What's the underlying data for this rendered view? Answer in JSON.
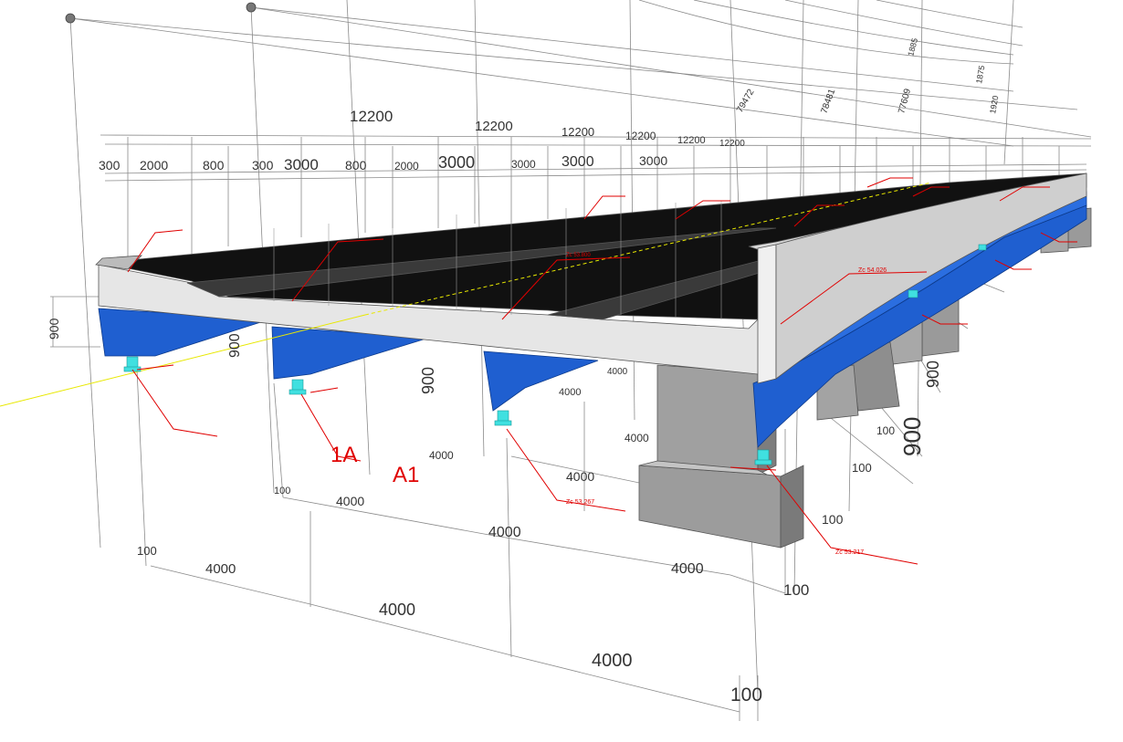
{
  "colors": {
    "background": "#ffffff",
    "dimension_line": "#8a8a8a",
    "deck_surface": "#111111",
    "deck_concrete": "#e6e6e6",
    "steel_girder": "#1f5fd0",
    "bearing": "#40e0e0",
    "pier": "#9a9a9a",
    "annotation": "#e00000",
    "centerline": "#e8e800"
  },
  "dimensions": {
    "top_spans": [
      "12200",
      "12200",
      "12200",
      "12200",
      "12200",
      "12200"
    ],
    "top_row_values": [
      "300",
      "2000",
      "800",
      "300",
      "3000",
      "800",
      "2000",
      "3000",
      "3000",
      "3000",
      "3000"
    ],
    "girder_heights": [
      "900",
      "900",
      "900",
      "900",
      "900"
    ],
    "bottom_spacing_row1": [
      "100",
      "4000",
      "4000",
      "4000",
      "100"
    ],
    "bottom_spacing_row2": [
      "100",
      "4000",
      "4000",
      "4000",
      "100"
    ],
    "right_side_values": [
      "4000",
      "4000",
      "4000",
      "100",
      "100",
      "100",
      "4000",
      "4000"
    ],
    "upper_diagonal_values": [
      "79472",
      "78481",
      "77609",
      "1885",
      "1875",
      "1920"
    ]
  },
  "labels": {
    "abutment_1": "1A",
    "abutment_2": "A1"
  },
  "elevation_tags": [
    "Zc 53.267",
    "Zc 53.217",
    "Zc 54.026",
    "Zc 53.800"
  ],
  "icons": [
    "view-pivot-sphere-icon",
    "view-pivot-sphere-icon"
  ]
}
